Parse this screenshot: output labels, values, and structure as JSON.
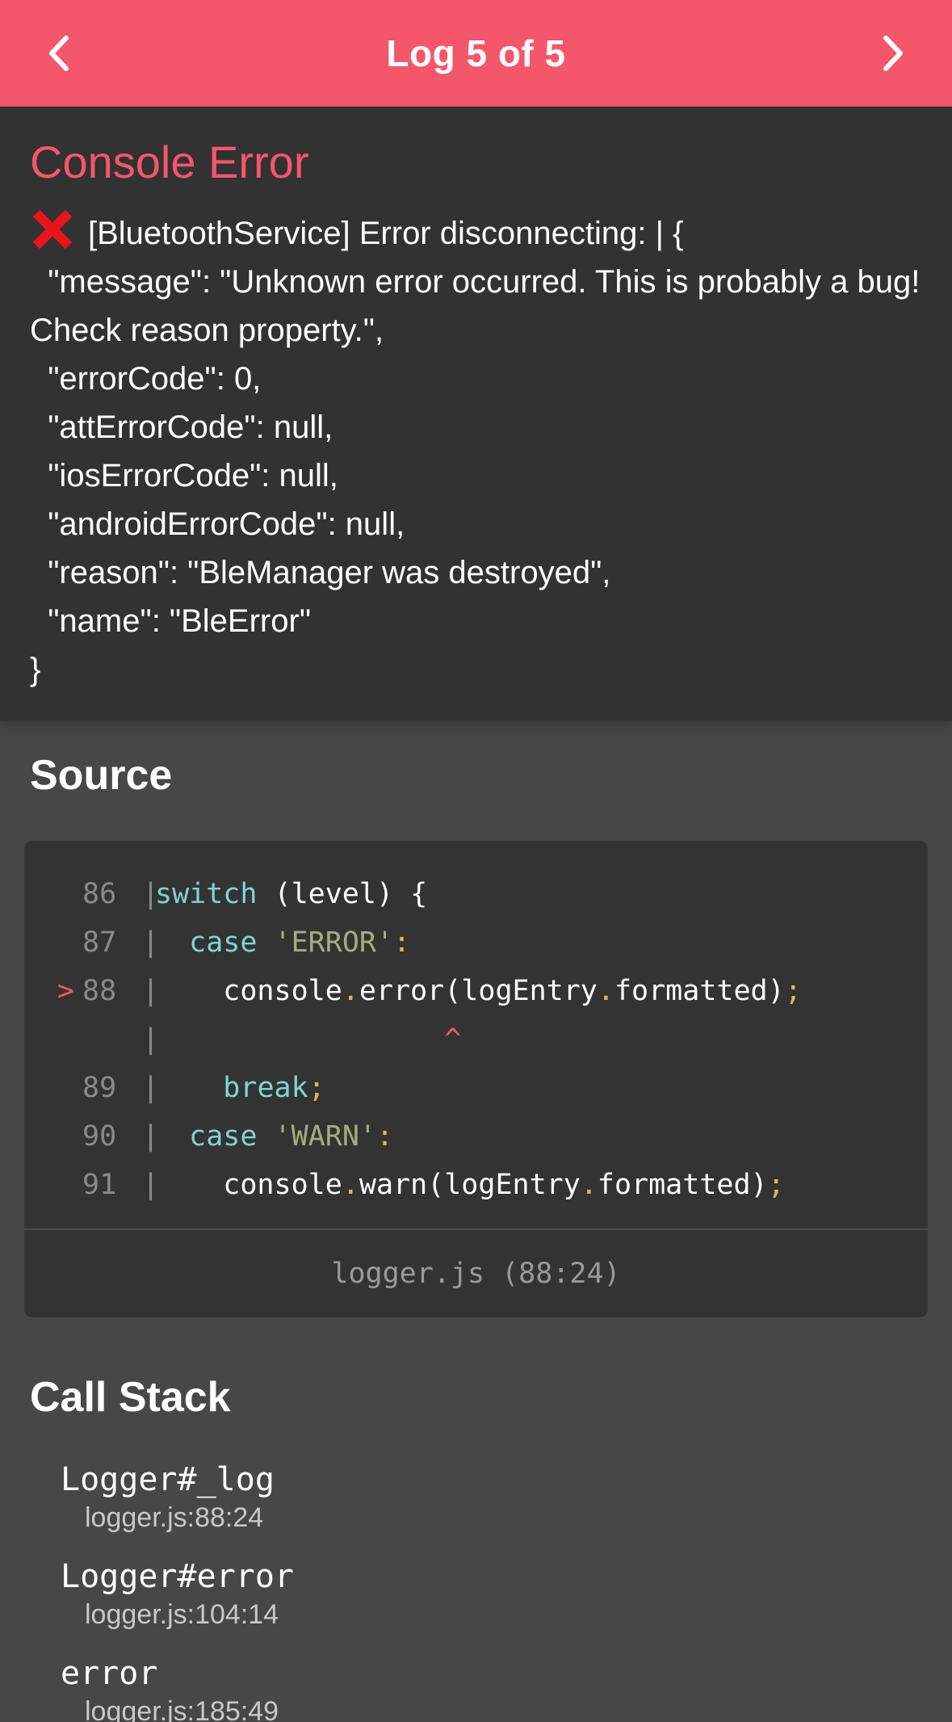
{
  "header": {
    "title": "Log 5 of 5",
    "prev_icon": "chevron-left-icon",
    "next_icon": "chevron-right-icon"
  },
  "error": {
    "title": "Console Error",
    "icon": "red-x-icon",
    "message": "[BluetoothService] Error disconnecting: | {\n  \"message\": \"Unknown error occurred. This is probably a bug! Check reason property.\",\n  \"errorCode\": 0,\n  \"attErrorCode\": null,\n  \"iosErrorCode\": null,\n  \"androidErrorCode\": null,\n  \"reason\": \"BleManager was destroyed\",\n  \"name\": \"BleError\"\n}"
  },
  "source": {
    "title": "Source",
    "lines": [
      {
        "marker": "",
        "num": "86",
        "bar": "|",
        "code": "switch (level) {"
      },
      {
        "marker": "",
        "num": "87",
        "bar": "|",
        "code": "  case 'ERROR':"
      },
      {
        "marker": ">",
        "num": "88",
        "bar": "|",
        "code": "    console.error(logEntry.formatted);"
      },
      {
        "marker": "",
        "num": "",
        "bar": "|",
        "code": "                 ^"
      },
      {
        "marker": "",
        "num": "89",
        "bar": "|",
        "code": "    break;"
      },
      {
        "marker": "",
        "num": "90",
        "bar": "|",
        "code": "  case 'WARN':"
      },
      {
        "marker": "",
        "num": "91",
        "bar": "|",
        "code": "    console.warn(logEntry.formatted);"
      }
    ],
    "file_location": "logger.js (88:24)"
  },
  "call_stack": {
    "title": "Call Stack",
    "frames": [
      {
        "fn": "Logger#_log",
        "loc": "logger.js:88:24"
      },
      {
        "fn": "Logger#error",
        "loc": "logger.js:104:14"
      },
      {
        "fn": "error",
        "loc": "logger.js:185:49"
      }
    ]
  },
  "colors": {
    "accent": "#f4566b",
    "panel_dark": "#323232",
    "background": "#474747",
    "keyword": "#7fd3d3",
    "string": "#a5ad7e",
    "punctuation": "#f0b04f"
  }
}
